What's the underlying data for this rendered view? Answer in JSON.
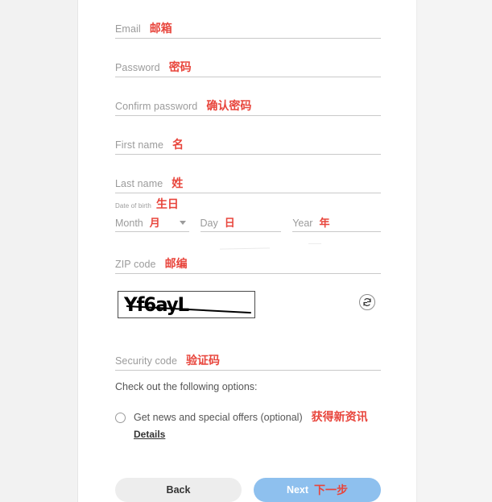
{
  "form": {
    "fields": [
      {
        "label": "Email",
        "annotation": "邮箱",
        "name": "email"
      },
      {
        "label": "Password",
        "annotation": "密码",
        "name": "password"
      },
      {
        "label": "Confirm password",
        "annotation": "确认密码",
        "name": "confirm-password"
      },
      {
        "label": "First name",
        "annotation": "名",
        "name": "first-name"
      },
      {
        "label": "Last name",
        "annotation": "姓",
        "name": "last-name"
      }
    ],
    "date_of_birth": {
      "label": "Date of birth",
      "annotation": "生日",
      "month": {
        "label": "Month",
        "annotation": "月"
      },
      "day": {
        "label": "Day",
        "annotation": "日"
      },
      "year": {
        "label": "Year",
        "annotation": "年"
      }
    },
    "zip": {
      "label": "ZIP code",
      "annotation": "邮编"
    },
    "captcha": {
      "text": "Yf6ayL",
      "refresh_icon": "refresh-icon"
    },
    "security_code": {
      "label": "Security code",
      "annotation": "验证码"
    },
    "options": {
      "heading": "Check out the following options:",
      "item_label": "Get news and special offers (optional)",
      "item_annotation": "获得新资讯",
      "details_link": "Details"
    }
  },
  "footer": {
    "back_label": "Back",
    "next_label": "Next",
    "next_annotation": "下一步"
  },
  "colors": {
    "annotation_red": "#e8453c",
    "next_button_blue": "#8ec0ee",
    "back_button_gray": "#ededed",
    "label_gray": "#9b9b9b",
    "underline_gray": "#c9c9c9"
  }
}
